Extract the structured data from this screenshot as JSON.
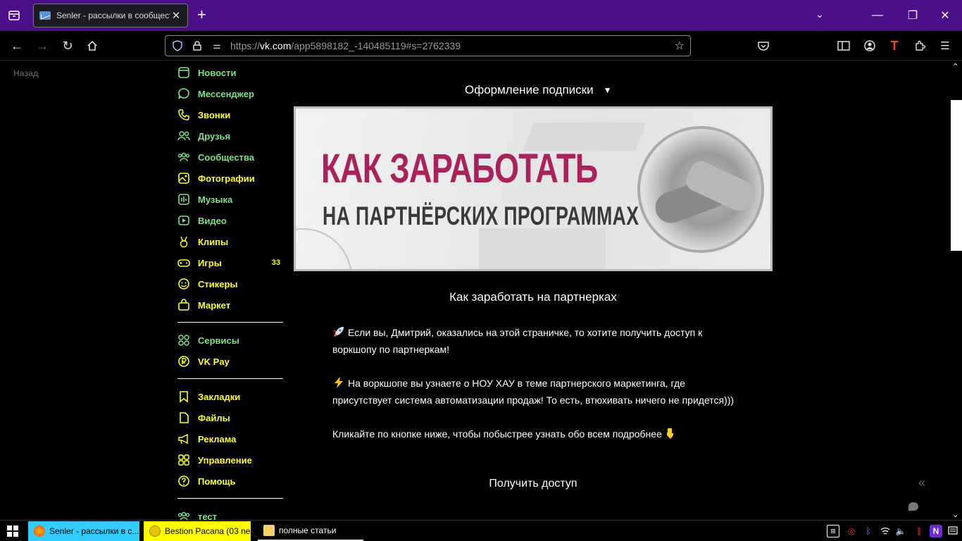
{
  "browser": {
    "tab_title": "Senler - рассылки в сообщест",
    "url_prefix": "https://",
    "url_domain": "vk.com",
    "url_path": "/app5898182_-140485119#s=2762339"
  },
  "sidebar": {
    "back_label": "Назад",
    "group1": [
      {
        "label": "Новости",
        "icon": "news-icon",
        "color": "green"
      },
      {
        "label": "Мессенджер",
        "icon": "messenger-icon",
        "color": "green"
      },
      {
        "label": "Звонки",
        "icon": "phone-icon",
        "color": "yellow"
      },
      {
        "label": "Друзья",
        "icon": "friends-icon",
        "color": "green"
      },
      {
        "label": "Сообщества",
        "icon": "communities-icon",
        "color": "green"
      },
      {
        "label": "Фотографии",
        "icon": "photos-icon",
        "color": "yellow"
      },
      {
        "label": "Музыка",
        "icon": "music-icon",
        "color": "green"
      },
      {
        "label": "Видео",
        "icon": "video-icon",
        "color": "green"
      },
      {
        "label": "Клипы",
        "icon": "clips-icon",
        "color": "yellow"
      },
      {
        "label": "Игры",
        "icon": "games-icon",
        "color": "yellow",
        "count": "33"
      },
      {
        "label": "Стикеры",
        "icon": "stickers-icon",
        "color": "yellow"
      },
      {
        "label": "Маркет",
        "icon": "market-icon",
        "color": "yellow"
      }
    ],
    "group2": [
      {
        "label": "Сервисы",
        "icon": "services-icon",
        "color": "green"
      },
      {
        "label": "VK Pay",
        "icon": "vkpay-icon",
        "color": "yellow"
      }
    ],
    "group3": [
      {
        "label": "Закладки",
        "icon": "bookmarks-icon",
        "color": "yellow"
      },
      {
        "label": "Файлы",
        "icon": "files-icon",
        "color": "yellow"
      },
      {
        "label": "Реклама",
        "icon": "ads-icon",
        "color": "yellow"
      },
      {
        "label": "Управление",
        "icon": "manage-icon",
        "color": "yellow"
      },
      {
        "label": "Помощь",
        "icon": "help-icon",
        "color": "yellow"
      }
    ],
    "group4": [
      {
        "label": "тест",
        "icon": "group-icon",
        "color": "green"
      }
    ]
  },
  "main": {
    "subscription_dropdown": "Оформление подписки",
    "banner_line1": "КАК ЗАРАБОТАТЬ",
    "banner_line2": "НА ПАРТНЁРСКИХ ПРОГРАММАХ",
    "post_title": "Как заработать на партнерках",
    "paragraph1": "Если вы, Дмитрий, оказались на этой страничке, то хотите получить доступ к воркшопу по партнеркам!",
    "paragraph2": "На воркшопе вы узнаете о НОУ ХАУ в теме партнерского маркетинга, где присутствует система автоматизации продаж! То есть, втюхивать ничего не придется)))",
    "paragraph3": "Кликайте по кнопке ниже, чтобы побыстрее узнать обо всем подробнее",
    "cta_label": "Получить доступ"
  },
  "taskbar": {
    "apps": [
      {
        "label": "Senler - рассылки в с...",
        "bg": "#33ccff"
      },
      {
        "label": "Bestion Pacana (03 ne",
        "bg": "#ffff00"
      },
      {
        "label": "полные статьи",
        "bg": "#000000"
      }
    ]
  },
  "colors": {
    "tabstrip": "#4b0f8a",
    "nav_green": "#7ee08a",
    "nav_yellow": "#ffff33",
    "banner_accent": "#a8225d"
  }
}
